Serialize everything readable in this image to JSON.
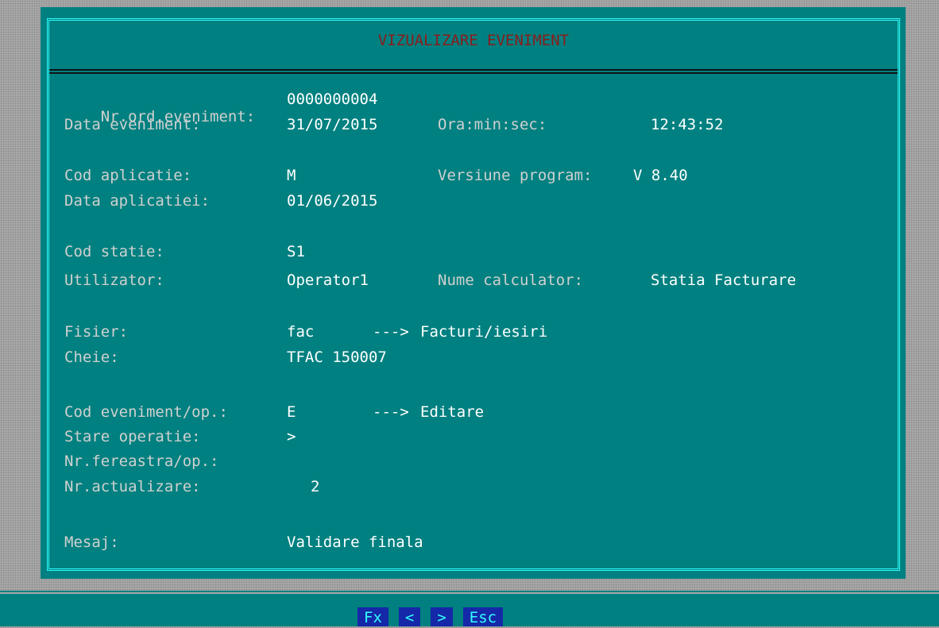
{
  "window": {
    "title": "VIZUALIZARE EVENIMENT"
  },
  "fields": [
    {
      "label": "Nr.ord.eveniment:",
      "value": "0000000004"
    },
    {
      "label": "Data eveniment:",
      "value": "31/07/2015",
      "label2": "Ora:min:sec:",
      "value2": "12:43:52"
    },
    {
      "label": "Cod aplicatie:",
      "value": "M",
      "label2": "Versiune program:",
      "value2": "V 8.40"
    },
    {
      "label": "Data aplicatiei:",
      "value": "01/06/2015"
    },
    {
      "label": "Cod statie:",
      "value": "S1"
    },
    {
      "label": "Utilizator:",
      "value": "Operator1",
      "label2": "Nume calculator:",
      "value2": "Statia Facturare"
    },
    {
      "label": "Fisier:",
      "value": "fac",
      "arrow": "--->",
      "value2": "Facturi/iesiri"
    },
    {
      "label": "Cheie:",
      "value": "TFAC 150007"
    },
    {
      "label": "Cod eveniment/op.:",
      "value": "E",
      "arrow": "--->",
      "value2": "Editare"
    },
    {
      "label": "Stare operatie:",
      "value": ">"
    },
    {
      "label": "Nr.fereastra/op.:",
      "value": ""
    },
    {
      "label": "Nr.actualizare:",
      "value": "2"
    },
    {
      "label": "Mesaj:",
      "value": "Validare finala"
    }
  ],
  "function_keys": [
    "Fx",
    "<",
    ">",
    "Esc"
  ]
}
